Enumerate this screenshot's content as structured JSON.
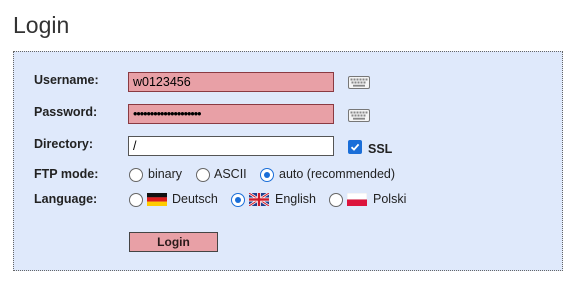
{
  "page": {
    "title": "Login"
  },
  "form": {
    "username": {
      "label": "Username:",
      "value": "w0123456"
    },
    "password": {
      "label": "Password:",
      "value": "••••••••••••••••••••"
    },
    "directory": {
      "label": "Directory:",
      "value": "/"
    },
    "ssl": {
      "label": "SSL",
      "checked": true
    },
    "ftp_mode": {
      "label": "FTP mode:",
      "options": [
        "binary",
        "ASCII",
        "auto (recommended)"
      ],
      "selected": "auto (recommended)"
    },
    "language": {
      "label": "Language:",
      "options": [
        "Deutsch",
        "English",
        "Polski"
      ],
      "selected": "English"
    },
    "submit_label": "Login"
  },
  "colors": {
    "field_highlight": "#e8a0a6",
    "box_background": "#dfe9fb",
    "accent": "#1a6ed8"
  },
  "icons": [
    "keyboard-icon",
    "check-icon",
    "flag-de-icon",
    "flag-gb-icon",
    "flag-pl-icon"
  ]
}
